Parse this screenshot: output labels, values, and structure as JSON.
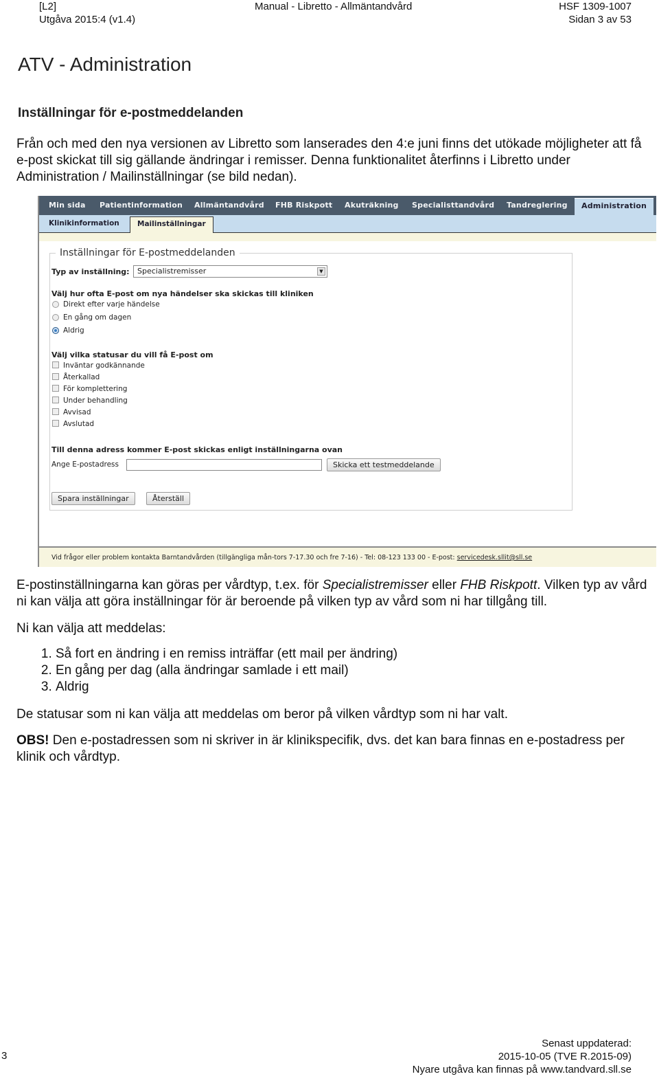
{
  "header": {
    "level": "[L2]",
    "edition": "Utgåva 2015:4 (v1.4)",
    "manual_title": "Manual - Libretto - Allmäntandvård",
    "doc_id": "HSF 1309-1007",
    "page_label": "Sidan 3 av 53"
  },
  "page_title": "ATV - Administration",
  "section_title": "Inställningar för e-postmeddelanden",
  "intro": "Från och med den nya versionen av Libretto som lanserades den 4:e juni finns det utökade möjligheter att få e-post skickat till sig gällande ändringar i remisser. Denna funktionalitet återfinns i Libretto under Administration / Mailinställningar (se bild nedan).",
  "screenshot": {
    "top_nav": [
      "Min sida",
      "Patientinformation",
      "Allmäntandvård",
      "FHB Riskpott",
      "Akuträkning",
      "Specialisttandvård",
      "Tandreglering",
      "Administration"
    ],
    "active_top": "Administration",
    "sub_nav": [
      "Klinikinformation",
      "Mailinställningar"
    ],
    "active_sub": "Mailinställningar",
    "legend": "Inställningar för E-postmeddelanden",
    "type_label": "Typ av inställning:",
    "type_value": "Specialistremisser",
    "frequency_heading": "Välj hur ofta E-post om nya händelser ska skickas till kliniken",
    "frequency_options": [
      "Direkt efter varje händelse",
      "En gång om dagen",
      "Aldrig"
    ],
    "frequency_selected": "Aldrig",
    "status_heading": "Välj vilka statusar du vill få E-post om",
    "status_options": [
      "Inväntar godkännande",
      "Återkallad",
      "För komplettering",
      "Under behandling",
      "Avvisad",
      "Avslutad"
    ],
    "address_heading": "Till denna adress kommer E-post skickas enligt inställningarna ovan",
    "email_label": "Ange E-postadress",
    "email_value": "",
    "test_button": "Skicka ett testmeddelande",
    "save_button": "Spara inställningar",
    "reset_button": "Återställ",
    "footer_text": "Vid frågor eller problem kontakta Barntandvården (tillgängliga mån-tors 7-17.30 och fre 7-16) - Tel: 08-123 133 00 - E-post: ",
    "footer_email": "servicedesk.sllit@sll.se"
  },
  "para2": {
    "part1": "E-postinställningarna kan göras per vårdtyp, t.ex. för ",
    "em1": "Specialistremisser",
    "part2": " eller ",
    "em2": "FHB Riskpott",
    "part3": ". Vilken typ av vård ni kan välja att göra inställningar för är beroende på vilken typ av vård som ni har tillgång till."
  },
  "para3": "Ni kan välja att meddelas:",
  "options_list": [
    "Så fort en ändring i en remiss inträffar (ett mail per ändring)",
    "En gång per dag (alla ändringar samlade i ett mail)",
    "Aldrig"
  ],
  "para4": "De statusar som ni kan välja att meddelas om beror på vilken vårdtyp som ni har valt.",
  "para5": {
    "bold": "OBS!",
    "rest": " Den e-postadressen som ni skriver in är klinikspecifik, dvs. det kan bara finnas en e-postadress per klinik och vårdtyp."
  },
  "footer": {
    "page_number": "3",
    "updated_label": "Senast uppdaterad:",
    "updated_value": "2015-10-05 (TVE R.2015-09)",
    "newer_edition": "Nyare utgåva kan finnas på www.tandvard.sll.se"
  }
}
